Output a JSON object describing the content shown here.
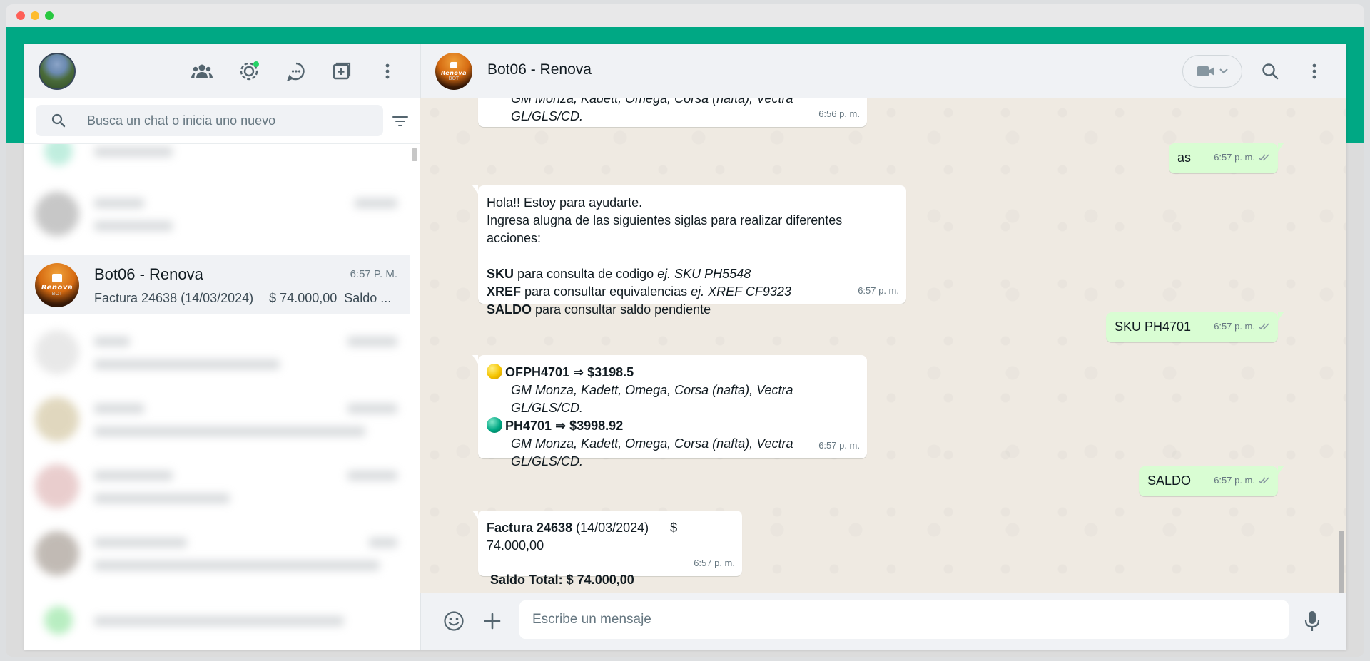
{
  "window": {
    "title_dots": [
      "close",
      "minimize",
      "maximize"
    ]
  },
  "left_header": {
    "icons": [
      "community-icon",
      "status-icon",
      "channels-icon",
      "new-chat-icon",
      "menu-icon"
    ]
  },
  "search": {
    "placeholder": "Busca un chat o inicia uno nuevo"
  },
  "chats": [
    {
      "name": "Bot06 - Renova",
      "time": "6:57 P. M.",
      "preview": "Factura 24638 (14/03/2024)",
      "preview_amount": "$ 74.000,00",
      "preview_tail": "Saldo ...",
      "active": true
    }
  ],
  "conversation": {
    "title": "Bot06 - Renova",
    "messages": {
      "partial_top": {
        "text": "GM Monza, Kadett, Omega, Corsa (nafta), Vectra GL/GLS/CD.",
        "time": "6:56 p. m."
      },
      "out_as": {
        "text": "as",
        "time": "6:57 p. m."
      },
      "welcome": {
        "line1": "Hola!! Estoy para ayudarte.",
        "line2": "Ingresa alugna de las siguientes siglas para realizar diferentes acciones:",
        "sku_key": "SKU",
        "sku_desc": " para consulta de codigo ",
        "sku_example": "ej. SKU PH5548",
        "xref_key": "XREF",
        "xref_desc": " para consultar equivalencias ",
        "xref_example": "ej. XREF CF9323",
        "saldo_key": "SALDO",
        "saldo_desc": " para consultar saldo pendiente",
        "time": "6:57 p. m."
      },
      "out_sku": {
        "text": "SKU PH4701",
        "time": "6:57 p. m."
      },
      "sku_result": {
        "item1_code": "OFPH4701 ⇒ $3198.5",
        "item1_desc": "GM Monza, Kadett, Omega, Corsa (nafta), Vectra GL/GLS/CD.",
        "item2_code": "PH4701 ⇒ $3998.92",
        "item2_desc": "GM Monza, Kadett, Omega, Corsa (nafta), Vectra GL/GLS/CD.",
        "time": "6:57 p. m."
      },
      "out_saldo": {
        "text": "SALDO",
        "time": "6:57 p. m."
      },
      "saldo_result": {
        "invoice_label": "Factura 24638",
        "invoice_date": " (14/03/2024)",
        "invoice_amount": "$ 74.000,00",
        "total": "Saldo Total: $ 74.000,00",
        "time": "6:57 p. m."
      }
    }
  },
  "composer": {
    "placeholder": "Escribe un mensaje"
  },
  "colors": {
    "brand_green": "#00a884",
    "outgoing_bubble": "#d9fdd3",
    "incoming_bubble": "#ffffff",
    "chat_bg": "#efeae2",
    "panel_header": "#f0f2f5"
  }
}
